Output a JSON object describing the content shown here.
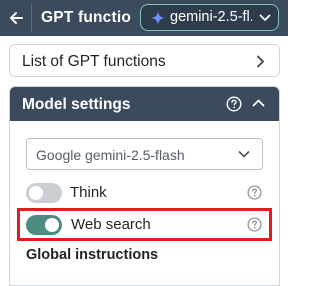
{
  "topbar": {
    "back_icon": "arrow-left-icon",
    "title": "GPT functio",
    "model_selector": {
      "icon": "sparkle-icon",
      "value": "gemini-2.5-fl...",
      "chevron_icon": "chevron-down-icon"
    }
  },
  "functions_row": {
    "label": "List of GPT functions",
    "chevron_icon": "chevron-right-icon"
  },
  "settings": {
    "title": "Model settings",
    "help_icon": "help-circle-icon",
    "collapse_icon": "chevron-up-icon",
    "model_select": {
      "value": "Google gemini-2.5-flash"
    },
    "toggles": [
      {
        "label": "Think",
        "on": false
      },
      {
        "label": "Web search",
        "on": true
      }
    ],
    "global_instructions_label": "Global instructions"
  },
  "colors": {
    "header_bg": "#3b4a5c",
    "toggle_on": "#4e8c80",
    "toggle_off": "#c9ced4",
    "highlight": "#e01e1e",
    "pill_border": "#7fc4b5",
    "sparkle": "#6f8cff"
  }
}
